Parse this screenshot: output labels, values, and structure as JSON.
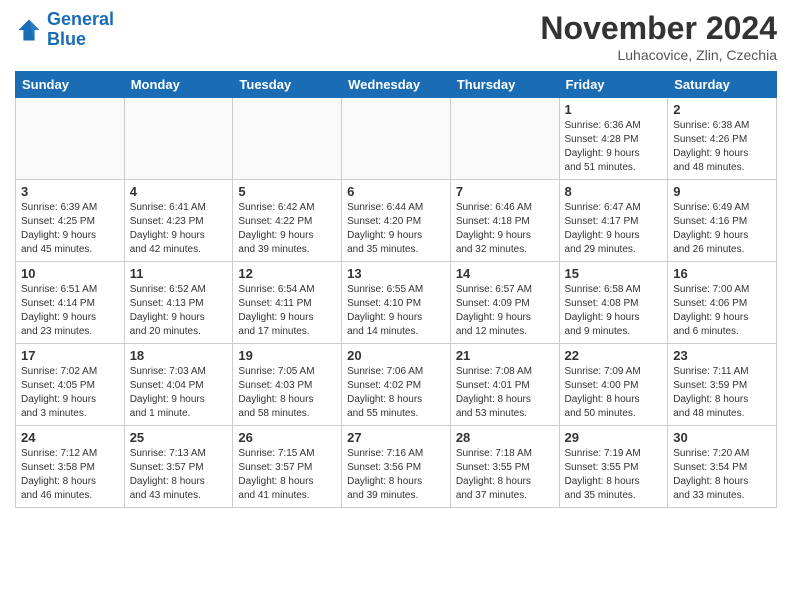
{
  "header": {
    "logo_line1": "General",
    "logo_line2": "Blue",
    "month": "November 2024",
    "location": "Luhacovice, Zlin, Czechia"
  },
  "days_of_week": [
    "Sunday",
    "Monday",
    "Tuesday",
    "Wednesday",
    "Thursday",
    "Friday",
    "Saturday"
  ],
  "weeks": [
    [
      {
        "day": "",
        "info": ""
      },
      {
        "day": "",
        "info": ""
      },
      {
        "day": "",
        "info": ""
      },
      {
        "day": "",
        "info": ""
      },
      {
        "day": "",
        "info": ""
      },
      {
        "day": "1",
        "info": "Sunrise: 6:36 AM\nSunset: 4:28 PM\nDaylight: 9 hours\nand 51 minutes."
      },
      {
        "day": "2",
        "info": "Sunrise: 6:38 AM\nSunset: 4:26 PM\nDaylight: 9 hours\nand 48 minutes."
      }
    ],
    [
      {
        "day": "3",
        "info": "Sunrise: 6:39 AM\nSunset: 4:25 PM\nDaylight: 9 hours\nand 45 minutes."
      },
      {
        "day": "4",
        "info": "Sunrise: 6:41 AM\nSunset: 4:23 PM\nDaylight: 9 hours\nand 42 minutes."
      },
      {
        "day": "5",
        "info": "Sunrise: 6:42 AM\nSunset: 4:22 PM\nDaylight: 9 hours\nand 39 minutes."
      },
      {
        "day": "6",
        "info": "Sunrise: 6:44 AM\nSunset: 4:20 PM\nDaylight: 9 hours\nand 35 minutes."
      },
      {
        "day": "7",
        "info": "Sunrise: 6:46 AM\nSunset: 4:18 PM\nDaylight: 9 hours\nand 32 minutes."
      },
      {
        "day": "8",
        "info": "Sunrise: 6:47 AM\nSunset: 4:17 PM\nDaylight: 9 hours\nand 29 minutes."
      },
      {
        "day": "9",
        "info": "Sunrise: 6:49 AM\nSunset: 4:16 PM\nDaylight: 9 hours\nand 26 minutes."
      }
    ],
    [
      {
        "day": "10",
        "info": "Sunrise: 6:51 AM\nSunset: 4:14 PM\nDaylight: 9 hours\nand 23 minutes."
      },
      {
        "day": "11",
        "info": "Sunrise: 6:52 AM\nSunset: 4:13 PM\nDaylight: 9 hours\nand 20 minutes."
      },
      {
        "day": "12",
        "info": "Sunrise: 6:54 AM\nSunset: 4:11 PM\nDaylight: 9 hours\nand 17 minutes."
      },
      {
        "day": "13",
        "info": "Sunrise: 6:55 AM\nSunset: 4:10 PM\nDaylight: 9 hours\nand 14 minutes."
      },
      {
        "day": "14",
        "info": "Sunrise: 6:57 AM\nSunset: 4:09 PM\nDaylight: 9 hours\nand 12 minutes."
      },
      {
        "day": "15",
        "info": "Sunrise: 6:58 AM\nSunset: 4:08 PM\nDaylight: 9 hours\nand 9 minutes."
      },
      {
        "day": "16",
        "info": "Sunrise: 7:00 AM\nSunset: 4:06 PM\nDaylight: 9 hours\nand 6 minutes."
      }
    ],
    [
      {
        "day": "17",
        "info": "Sunrise: 7:02 AM\nSunset: 4:05 PM\nDaylight: 9 hours\nand 3 minutes."
      },
      {
        "day": "18",
        "info": "Sunrise: 7:03 AM\nSunset: 4:04 PM\nDaylight: 9 hours\nand 1 minute."
      },
      {
        "day": "19",
        "info": "Sunrise: 7:05 AM\nSunset: 4:03 PM\nDaylight: 8 hours\nand 58 minutes."
      },
      {
        "day": "20",
        "info": "Sunrise: 7:06 AM\nSunset: 4:02 PM\nDaylight: 8 hours\nand 55 minutes."
      },
      {
        "day": "21",
        "info": "Sunrise: 7:08 AM\nSunset: 4:01 PM\nDaylight: 8 hours\nand 53 minutes."
      },
      {
        "day": "22",
        "info": "Sunrise: 7:09 AM\nSunset: 4:00 PM\nDaylight: 8 hours\nand 50 minutes."
      },
      {
        "day": "23",
        "info": "Sunrise: 7:11 AM\nSunset: 3:59 PM\nDaylight: 8 hours\nand 48 minutes."
      }
    ],
    [
      {
        "day": "24",
        "info": "Sunrise: 7:12 AM\nSunset: 3:58 PM\nDaylight: 8 hours\nand 46 minutes."
      },
      {
        "day": "25",
        "info": "Sunrise: 7:13 AM\nSunset: 3:57 PM\nDaylight: 8 hours\nand 43 minutes."
      },
      {
        "day": "26",
        "info": "Sunrise: 7:15 AM\nSunset: 3:57 PM\nDaylight: 8 hours\nand 41 minutes."
      },
      {
        "day": "27",
        "info": "Sunrise: 7:16 AM\nSunset: 3:56 PM\nDaylight: 8 hours\nand 39 minutes."
      },
      {
        "day": "28",
        "info": "Sunrise: 7:18 AM\nSunset: 3:55 PM\nDaylight: 8 hours\nand 37 minutes."
      },
      {
        "day": "29",
        "info": "Sunrise: 7:19 AM\nSunset: 3:55 PM\nDaylight: 8 hours\nand 35 minutes."
      },
      {
        "day": "30",
        "info": "Sunrise: 7:20 AM\nSunset: 3:54 PM\nDaylight: 8 hours\nand 33 minutes."
      }
    ]
  ]
}
